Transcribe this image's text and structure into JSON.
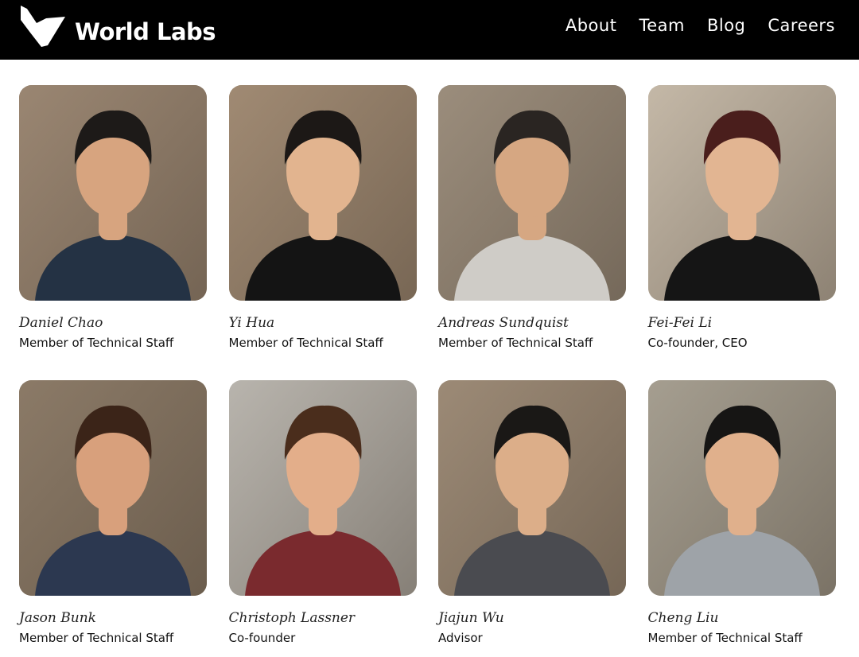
{
  "brand": {
    "name": "World Labs"
  },
  "nav": {
    "items": [
      {
        "label": "About"
      },
      {
        "label": "Team"
      },
      {
        "label": "Blog"
      },
      {
        "label": "Careers"
      }
    ]
  },
  "team": [
    {
      "name": "Daniel Chao",
      "role": "Member of Technical Staff",
      "bg": "#9a8672",
      "skin": "#d7a47f",
      "hair": "#1d1a18",
      "shirt": "#243244"
    },
    {
      "name": "Yi Hua",
      "role": "Member of Technical Staff",
      "bg": "#a08a73",
      "skin": "#e2b48f",
      "hair": "#1c1816",
      "shirt": "#141414"
    },
    {
      "name": "Andreas Sundquist",
      "role": "Member of Technical Staff",
      "bg": "#9b8d7c",
      "skin": "#d6a782",
      "hair": "#2a2522",
      "shirt": "#cfccc7"
    },
    {
      "name": "Fei-Fei Li",
      "role": "Co-founder, CEO",
      "bg": "#c4b8a7",
      "skin": "#e2b592",
      "hair": "#4a1e1c",
      "shirt": "#151515"
    },
    {
      "name": "Jason Bunk",
      "role": "Member of Technical Staff",
      "bg": "#8b7a67",
      "skin": "#d8a07c",
      "hair": "#3b2418",
      "shirt": "#2c3850"
    },
    {
      "name": "Christoph Lassner",
      "role": "Co-founder",
      "bg": "#b8b4ad",
      "skin": "#e3ae8a",
      "hair": "#4a2d1c",
      "shirt": "#7a2a2e"
    },
    {
      "name": "Jiajun Wu",
      "role": "Advisor",
      "bg": "#9c8a76",
      "skin": "#dcae89",
      "hair": "#1a1816",
      "shirt": "#4a4b50"
    },
    {
      "name": "Cheng Liu",
      "role": "Member of Technical Staff",
      "bg": "#a59e90",
      "skin": "#e0b08c",
      "hair": "#161514",
      "shirt": "#9ea3a8"
    }
  ]
}
